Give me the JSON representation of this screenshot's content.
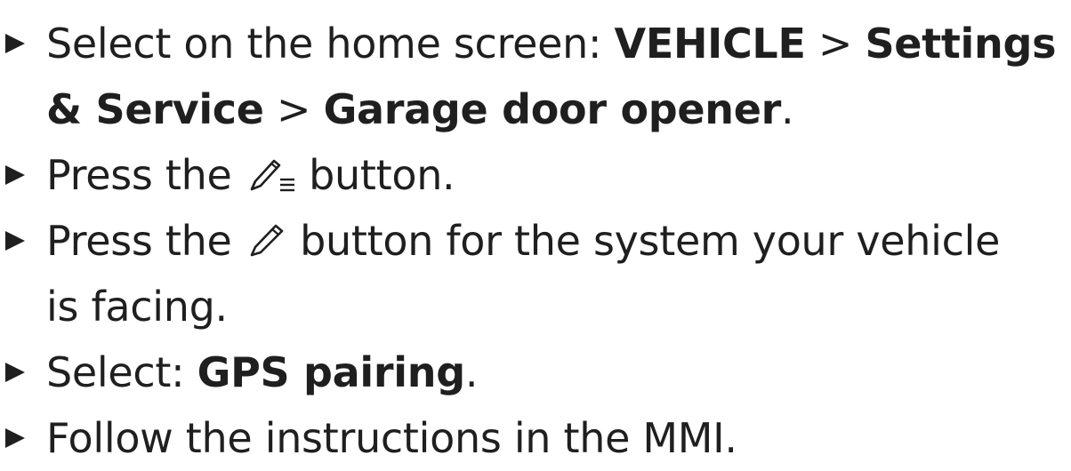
{
  "steps": [
    {
      "lead": "Select on the home screen: ",
      "path1": "VEHICLE",
      "sep1": " > ",
      "path2": "Settings",
      "cont_path2": "& Service",
      "sep2": " > ",
      "path3": "Garage door opener",
      "end": "."
    },
    {
      "before": "Press the ",
      "icon": "pencil-list-icon",
      "after": " button."
    },
    {
      "before": "Press the ",
      "icon": "pencil-icon",
      "after": " button for the system your vehicle",
      "cont": "is facing."
    },
    {
      "lead": "Select: ",
      "bold": "GPS pairing",
      "end": "."
    },
    {
      "text": "Follow the instructions in the MMI."
    }
  ],
  "colors": {
    "text": "#1f1f1f",
    "background": "#ffffff"
  }
}
